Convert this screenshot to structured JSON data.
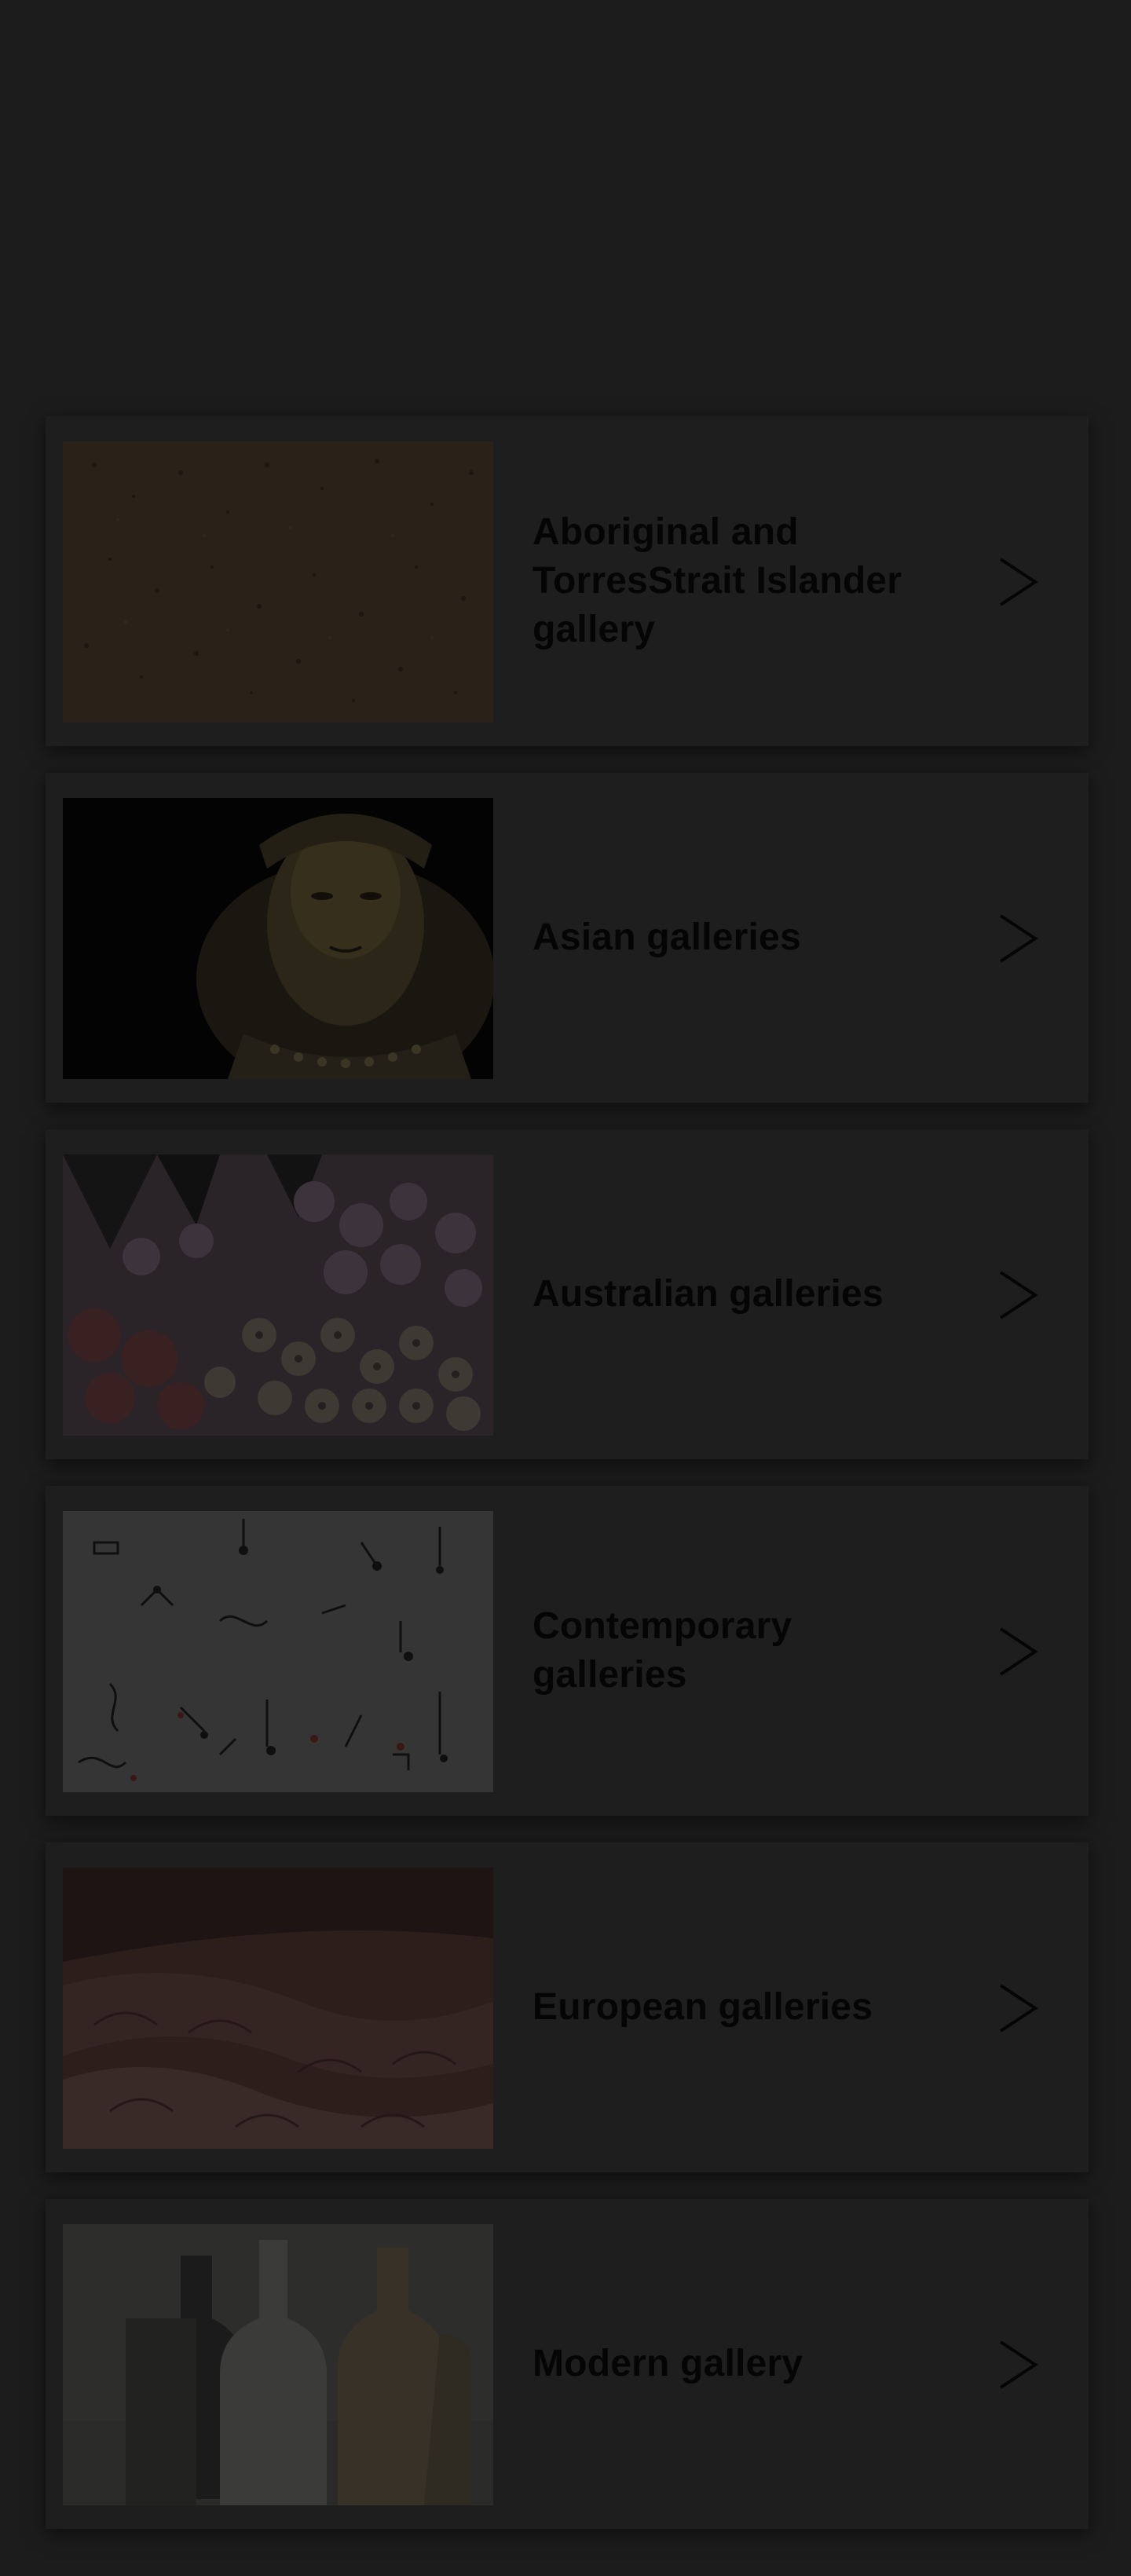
{
  "galleries": [
    {
      "title": "Aboriginal and TorresStrait Islander gallery",
      "image": "bark-texture-image"
    },
    {
      "title": "Asian galleries",
      "image": "buddha-statue-image"
    },
    {
      "title": "Australian galleries",
      "image": "flower-painting-image"
    },
    {
      "title": "Contemporary galleries",
      "image": "scattered-objects-image"
    },
    {
      "title": "European galleries",
      "image": "drapery-painting-image"
    },
    {
      "title": "Modern gallery",
      "image": "bottles-still-life-image"
    }
  ],
  "arrow_icon": "chevron-right-icon",
  "colors": {
    "page_background": "#1c1c1c",
    "card_background": "#1e1e1e",
    "title_text": "#050505"
  }
}
